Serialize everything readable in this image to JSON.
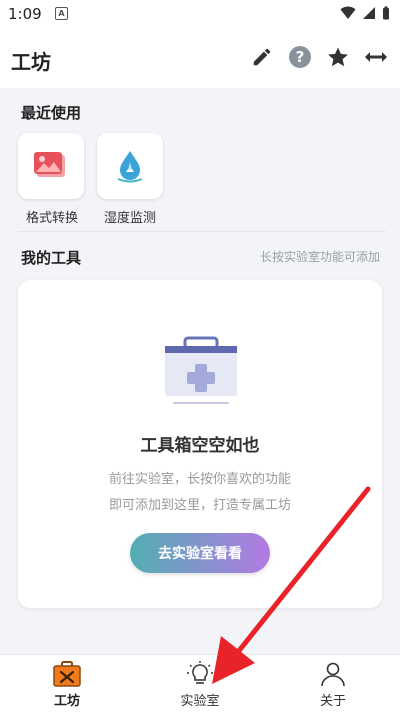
{
  "status": {
    "time": "1:09"
  },
  "appbar": {
    "title": "工坊"
  },
  "recent": {
    "title": "最近使用",
    "items": [
      {
        "label": "格式转换",
        "icon": "image-convert-icon"
      },
      {
        "label": "湿度监测",
        "icon": "water-drop-icon"
      }
    ]
  },
  "tools": {
    "title": "我的工具",
    "hint": "长按实验室功能可添加",
    "empty_title": "工具箱空空如也",
    "empty_desc_line1": "前往实验室，长按你喜欢的功能",
    "empty_desc_line2": "即可添加到这里，打造专属工坊",
    "button_label": "去实验室看看"
  },
  "nav": {
    "items": [
      {
        "label": "工坊",
        "icon": "toolbox-icon",
        "active": true
      },
      {
        "label": "实验室",
        "icon": "lightbulb-icon",
        "active": false
      },
      {
        "label": "关于",
        "icon": "person-icon",
        "active": false
      }
    ]
  },
  "colors": {
    "accent_start": "#52aeb2",
    "accent_end": "#b37ae4",
    "annotation_arrow": "#e8242a"
  }
}
